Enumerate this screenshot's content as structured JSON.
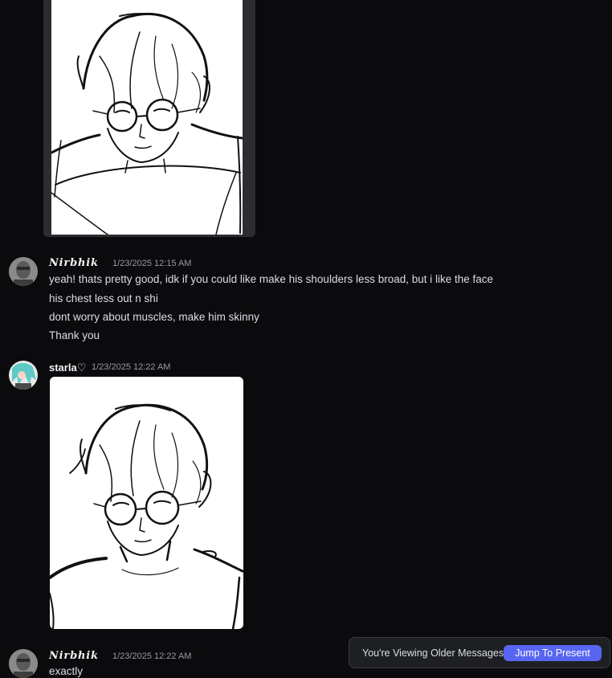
{
  "messages": [
    {
      "username": "𝑵𝒊𝒓𝒃𝒉𝒊𝒌",
      "timestamp": "1/23/2025 12:15 AM",
      "lines": [
        "yeah! thats pretty good, idk if you could like make his shoulders less broad, but i like the face",
        "his chest less out n shi",
        "dont worry about muscles, make him skinny",
        "Thank you"
      ]
    },
    {
      "username": "starla♡",
      "timestamp": "1/23/2025 12:22 AM"
    },
    {
      "username": "𝑵𝒊𝒓𝒃𝒉𝒊𝒌",
      "timestamp": "1/23/2025 12:22 AM",
      "lines": [
        "exactly"
      ]
    }
  ],
  "banner": {
    "text": "You're Viewing Older Messages",
    "button": "Jump To Present"
  },
  "colors": {
    "background": "#0b0b0d",
    "accent": "#5865f2",
    "timestamp": "#949ba4"
  }
}
